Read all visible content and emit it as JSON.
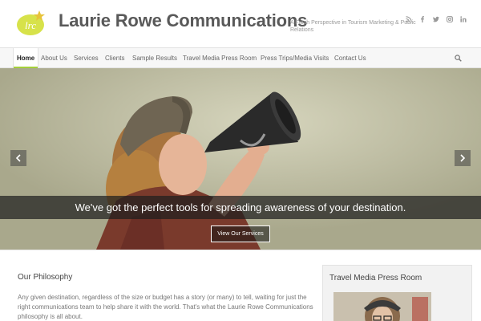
{
  "header": {
    "logo_text": "lrc",
    "site_title": "Laurie Rowe Communications",
    "tagline": "A Fresh Perspective in Tourism Marketing & Public Relations",
    "social_icons": [
      "rss-icon",
      "facebook-icon",
      "twitter-icon",
      "instagram-icon",
      "linkedin-icon"
    ]
  },
  "nav": {
    "items": [
      {
        "label": "Home",
        "active": true
      },
      {
        "label": "About Us"
      },
      {
        "label": "Services"
      },
      {
        "label": "Clients"
      },
      {
        "label": "Sample Results"
      },
      {
        "label": "Travel Media Press Room"
      },
      {
        "label": "Press Trips/Media Visits"
      },
      {
        "label": "Contact Us"
      }
    ],
    "search_icon": "search-icon"
  },
  "hero": {
    "caption": "We've got the perfect tools for spreading awareness of your destination.",
    "button_label": "View Our Services",
    "prev_icon": "chevron-left-icon",
    "next_icon": "chevron-right-icon"
  },
  "main": {
    "heading": "Our Philosophy",
    "body": "Any given destination, regardless of the size or budget has a story (or many) to tell, waiting for just the right communications team to help share it with the world. That's what the Laurie Rowe Communications philosophy is all about."
  },
  "sidebar": {
    "widget_title": "Travel Media Press Room"
  },
  "colors": {
    "accent": "#a5d03b",
    "title": "#595959",
    "logo_yellow": "#d7e24a"
  }
}
